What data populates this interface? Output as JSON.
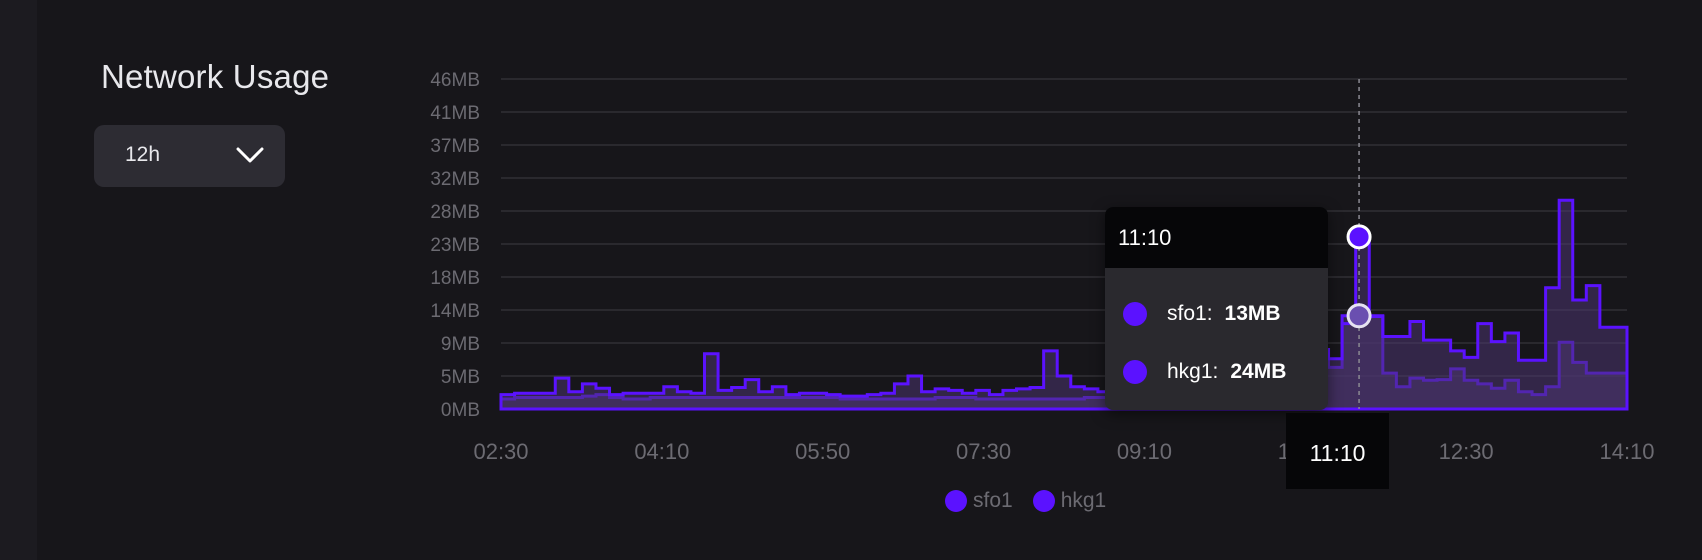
{
  "panel": {
    "title": "Network Usage",
    "range_select": {
      "value": "12h",
      "icon": "chevron-down-icon"
    }
  },
  "colors": {
    "accent": "#5b12ff",
    "fill": "#4b3470",
    "grid": "#36353b",
    "text_muted": "#6c6b72"
  },
  "chart_data": {
    "type": "area",
    "step": true,
    "ylim": [
      0,
      46
    ],
    "y_ticks": [
      "0MB",
      "5MB",
      "9MB",
      "14MB",
      "18MB",
      "23MB",
      "28MB",
      "32MB",
      "37MB",
      "41MB",
      "46MB"
    ],
    "x_ticks": [
      "02:30",
      "04:10",
      "05:50",
      "07:30",
      "09:10",
      "10:50",
      "12:30",
      "14:10"
    ],
    "grid": true,
    "legend_position": "bottom",
    "series": [
      {
        "name": "sfo1",
        "values": [
          1.4,
          1.6,
          1.6,
          1.6,
          1.6,
          1.6,
          1.8,
          2.0,
          1.6,
          1.4,
          1.4,
          1.6,
          1.6,
          1.6,
          1.6,
          1.6,
          1.6,
          1.6,
          1.6,
          1.6,
          1.6,
          1.6,
          1.6,
          1.6,
          1.6,
          1.4,
          1.4,
          1.4,
          1.4,
          1.4,
          1.4,
          1.4,
          1.6,
          1.6,
          1.6,
          1.4,
          1.4,
          1.4,
          1.4,
          1.4,
          1.4,
          1.4,
          1.4,
          1.6,
          1.6,
          1.6,
          1.6,
          1.6,
          1.6,
          1.6,
          2.0,
          2.6,
          4.1,
          5.8,
          5.4,
          3.5,
          3.5,
          3.5,
          10.9,
          9.3,
          7.0,
          5.8,
          13.0,
          13.0,
          13.0,
          5.0,
          3.1,
          4.3,
          4.0,
          4.1,
          5.6,
          4.0,
          3.5,
          2.9,
          4.0,
          2.4,
          2.0,
          3.1,
          9.3,
          6.5,
          5.0,
          5.0,
          5.0
        ]
      },
      {
        "name": "hkg1",
        "values": [
          2.0,
          2.2,
          2.2,
          2.2,
          4.3,
          2.4,
          3.5,
          2.9,
          2.0,
          2.2,
          2.2,
          2.2,
          3.1,
          2.4,
          2.2,
          7.7,
          2.6,
          3.0,
          4.1,
          2.4,
          3.1,
          2.0,
          2.2,
          2.2,
          2.0,
          1.8,
          1.8,
          2.0,
          2.2,
          3.5,
          4.6,
          2.4,
          2.8,
          2.6,
          2.2,
          2.6,
          2.0,
          2.6,
          2.8,
          3.0,
          8.1,
          4.6,
          3.1,
          2.8,
          2.4,
          2.6,
          4.1,
          3.5,
          3.1,
          2.6,
          4.5,
          3.5,
          2.8,
          5.0,
          8.0,
          5.0,
          2.8,
          2.4,
          3.0,
          10.4,
          8.3,
          7.0,
          11.9,
          24.0,
          12.9,
          10.1,
          10.1,
          12.2,
          9.6,
          9.6,
          8.1,
          7.2,
          11.9,
          9.4,
          10.6,
          6.8,
          6.8,
          16.9,
          29.1,
          15.2,
          17.2,
          11.4,
          11.4
        ]
      }
    ],
    "highlight": {
      "x_label": "11:10",
      "values": [
        {
          "series": "sfo1",
          "value": "13MB"
        },
        {
          "series": "hkg1",
          "value": "24MB"
        }
      ]
    }
  },
  "tooltip": {
    "time": "11:10",
    "rows": [
      {
        "label": "sfo1:",
        "value": "13MB"
      },
      {
        "label": "hkg1:",
        "value": "24MB"
      }
    ]
  },
  "x_highlight_label": "11:10",
  "legend": [
    "sfo1",
    "hkg1"
  ]
}
